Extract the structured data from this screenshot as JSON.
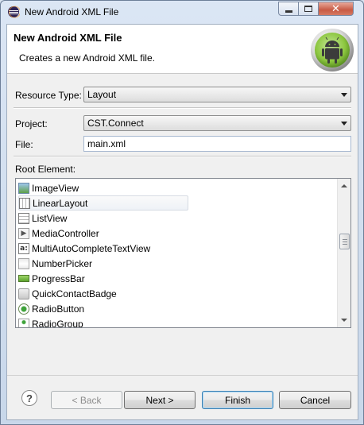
{
  "window": {
    "title": "New Android XML File"
  },
  "header": {
    "title": "New Android XML File",
    "description": "Creates a new Android XML file."
  },
  "form": {
    "resource_type_label": "Resource Type:",
    "resource_type_value": "Layout",
    "project_label": "Project:",
    "project_value": "CST.Connect",
    "file_label": "File:",
    "file_value": "main.xml",
    "root_element_label": "Root Element:"
  },
  "root_elements": [
    {
      "label": "ImageView",
      "icon": "imageview-icon"
    },
    {
      "label": "LinearLayout",
      "icon": "linearlayout-icon"
    },
    {
      "label": "ListView",
      "icon": "listview-icon"
    },
    {
      "label": "MediaController",
      "icon": "mediacontroller-icon"
    },
    {
      "label": "MultiAutoCompleteTextView",
      "icon": "autocomplete-icon"
    },
    {
      "label": "NumberPicker",
      "icon": "numberpicker-icon"
    },
    {
      "label": "ProgressBar",
      "icon": "progressbar-icon"
    },
    {
      "label": "QuickContactBadge",
      "icon": "contactbadge-icon"
    },
    {
      "label": "RadioButton",
      "icon": "radiobutton-icon"
    },
    {
      "label": "RadioGroup",
      "icon": "radiogroup-icon"
    }
  ],
  "buttons": {
    "help": "?",
    "back": "< Back",
    "next": "Next >",
    "finish": "Finish",
    "cancel": "Cancel"
  },
  "colors": {
    "android_green": "#8cc63f",
    "title_gradient": "#dbe6f4"
  }
}
